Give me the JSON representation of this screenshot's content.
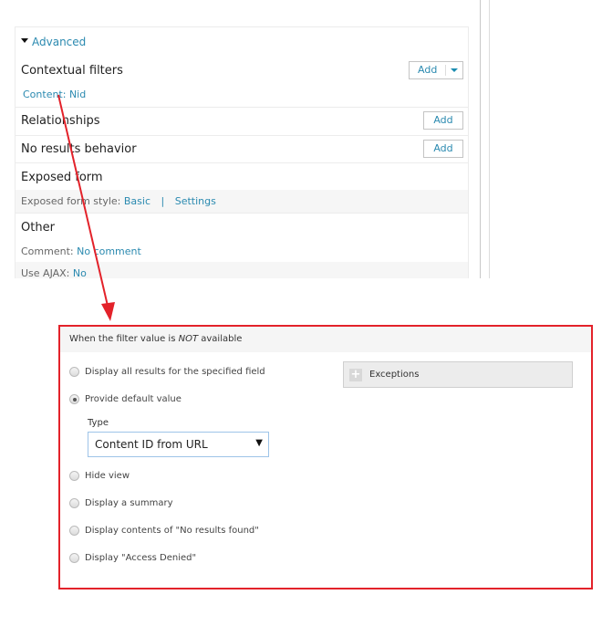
{
  "advanced": {
    "toggle_label": "Advanced",
    "sections": {
      "contextual_filters": {
        "title": "Contextual filters",
        "add_label": "Add",
        "items": [
          "Content: Nid"
        ]
      },
      "relationships": {
        "title": "Relationships",
        "add_label": "Add"
      },
      "no_results": {
        "title": "No results behavior",
        "add_label": "Add"
      },
      "exposed_form": {
        "title": "Exposed form",
        "style_label": "Exposed form style:",
        "style_value": "Basic",
        "separator": "|",
        "settings_label": "Settings"
      },
      "other": {
        "title": "Other",
        "comment_label": "Comment:",
        "comment_value": "No comment",
        "ajax_label": "Use AJAX:",
        "ajax_value": "No"
      }
    }
  },
  "dialog": {
    "header_prefix": "When the filter value is ",
    "header_em": "NOT",
    "header_suffix": " available",
    "options": [
      {
        "label": "Display all results for the specified field",
        "checked": false
      },
      {
        "label": "Provide default value",
        "checked": true
      },
      {
        "label": "Hide view",
        "checked": false
      },
      {
        "label": "Display a summary",
        "checked": false
      },
      {
        "label": "Display contents of \"No results found\"",
        "checked": false
      },
      {
        "label": "Display \"Access Denied\"",
        "checked": false
      }
    ],
    "type_label": "Type",
    "type_value": "Content ID from URL",
    "exceptions_label": "Exceptions"
  },
  "colors": {
    "link": "#2b8ab0",
    "annotation": "#e3222a"
  }
}
